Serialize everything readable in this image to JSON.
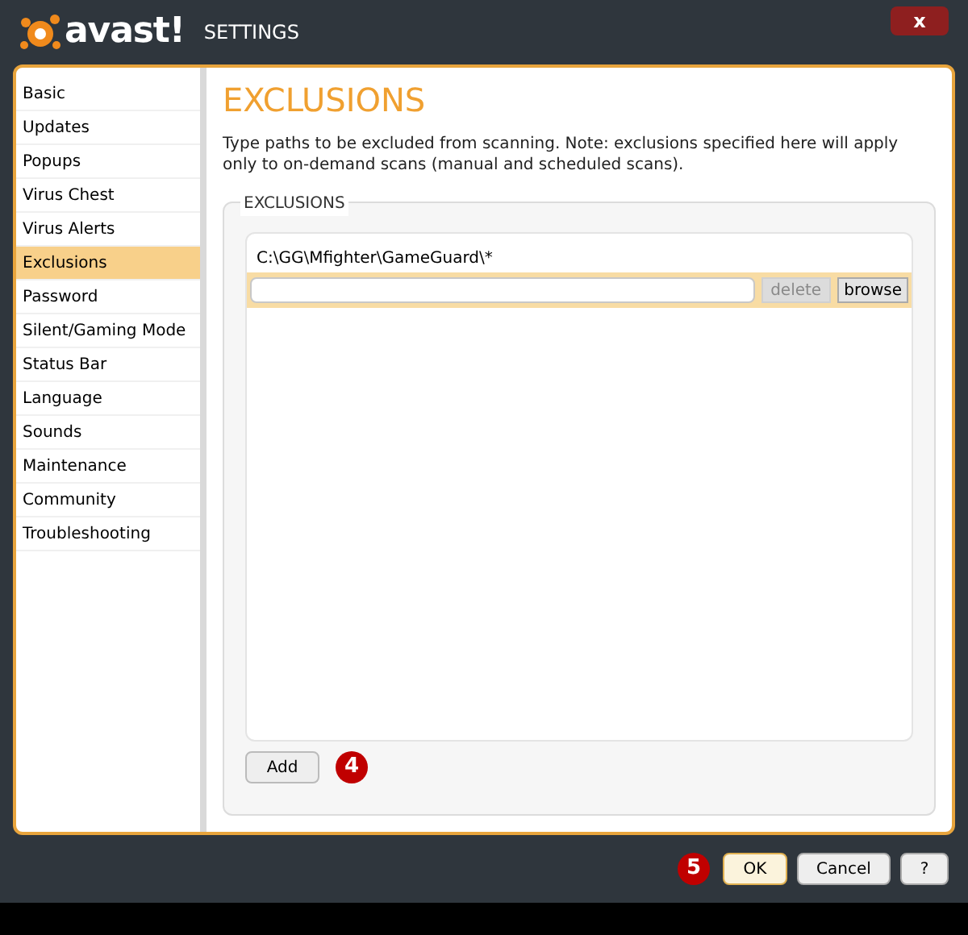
{
  "window": {
    "logo": "avast!",
    "title": "SETTINGS",
    "close_button": "x"
  },
  "sidebar": {
    "items": [
      {
        "label": "Basic",
        "selected": false
      },
      {
        "label": "Updates",
        "selected": false
      },
      {
        "label": "Popups",
        "selected": false
      },
      {
        "label": "Virus Chest",
        "selected": false
      },
      {
        "label": "Virus Alerts",
        "selected": false
      },
      {
        "label": "Exclusions",
        "selected": true
      },
      {
        "label": "Password",
        "selected": false
      },
      {
        "label": "Silent/Gaming Mode",
        "selected": false
      },
      {
        "label": "Status Bar",
        "selected": false
      },
      {
        "label": "Language",
        "selected": false
      },
      {
        "label": "Sounds",
        "selected": false
      },
      {
        "label": "Maintenance",
        "selected": false
      },
      {
        "label": "Community",
        "selected": false
      },
      {
        "label": "Troubleshooting",
        "selected": false
      }
    ]
  },
  "page": {
    "heading": "EXCLUSIONS",
    "description": "Type paths to be excluded from scanning. Note: exclusions specified here will apply only to on-demand scans (manual and scheduled scans).",
    "group": {
      "title": "EXCLUSIONS",
      "paths": [
        "C:\\GG\\Mfighter\\GameGuard\\*"
      ],
      "edit_row": {
        "delete_button": {
          "label": "delete",
          "disabled": true
        },
        "browse_button": {
          "label": "browse",
          "disabled": false
        }
      },
      "add_button": "Add",
      "callout": "4"
    }
  },
  "footer": {
    "callout": "5",
    "buttons": [
      {
        "label": "OK",
        "default": true
      },
      {
        "label": "Cancel",
        "default": false
      },
      {
        "label": "?",
        "default": false
      }
    ]
  }
}
